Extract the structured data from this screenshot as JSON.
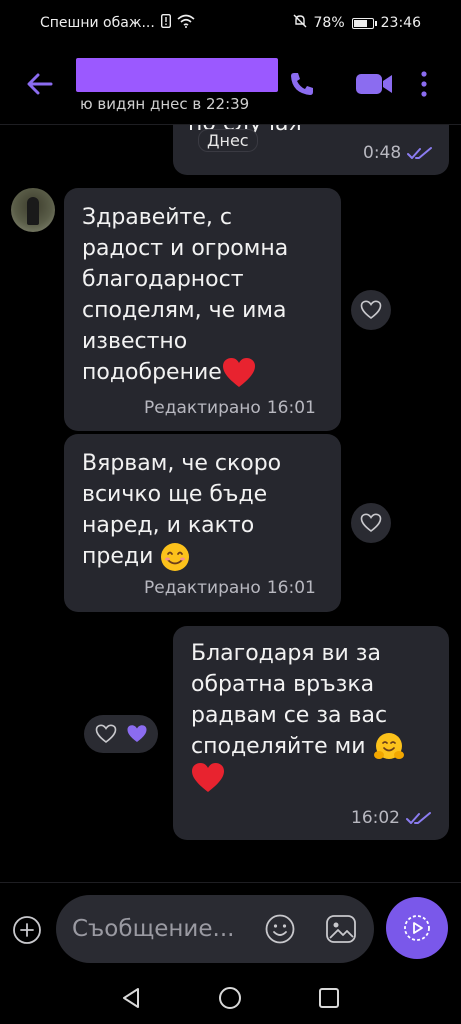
{
  "status_bar": {
    "carrier": "Спешни обаж...",
    "battery": "78%",
    "battery_level": 0.78,
    "time": "23:46"
  },
  "header": {
    "last_seen": "ю видян днес в 22:39",
    "accent_color": "#8b6cf0"
  },
  "chat": {
    "date_chip": "Днес",
    "cut_text": "по случая",
    "messages": [
      {
        "direction": "outgoing",
        "time": "0:48"
      },
      {
        "direction": "incoming",
        "lines": [
          "Здравейте, с",
          "радост и огромна",
          "благодарност",
          "споделям, че има",
          "известно",
          "подобрение"
        ],
        "emoji": "red-heart",
        "edited": "Редактирано",
        "time": "16:01"
      },
      {
        "direction": "incoming",
        "lines": [
          "Вярвам, че скоро",
          "всичко ще бъде",
          "наред, и както",
          "преди"
        ],
        "emoji": "smiling-face",
        "edited": "Редактирано",
        "time": "16:01"
      },
      {
        "direction": "outgoing",
        "lines": [
          "Благодаря ви за",
          "обратна връзка",
          "радвам се за вас",
          "споделяйте ми"
        ],
        "emoji": [
          "hugging-face",
          "red-heart"
        ],
        "time": "16:02"
      }
    ]
  },
  "composer": {
    "placeholder": "Съобщение..."
  },
  "colors": {
    "bubble": "#26272e",
    "send_button": "#7a58ea",
    "tick": "#8b7cf0",
    "heart": "#e8232f"
  }
}
